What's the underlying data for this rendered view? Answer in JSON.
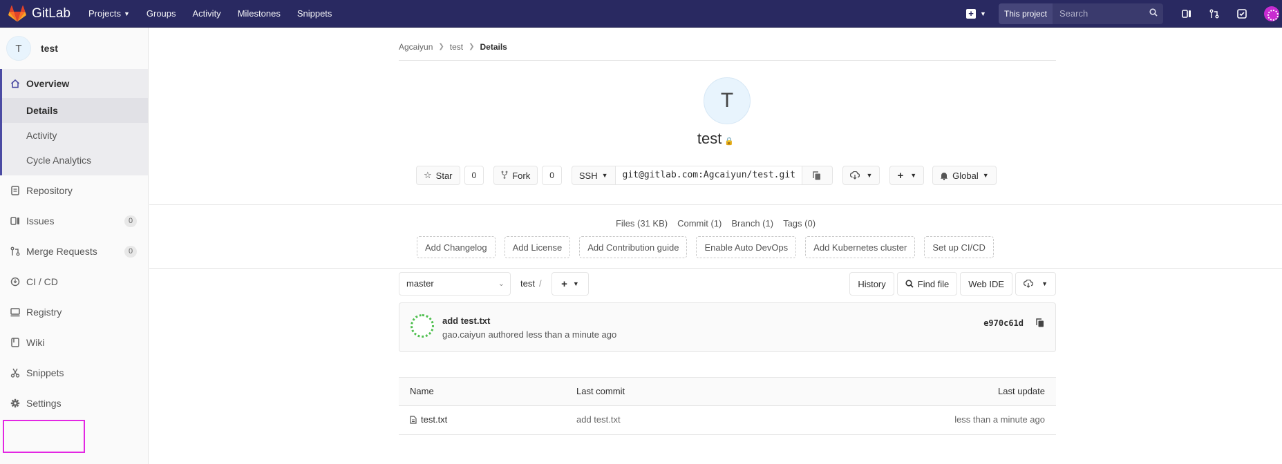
{
  "nav": {
    "brand": "GitLab",
    "links": [
      "Projects",
      "Groups",
      "Activity",
      "Milestones",
      "Snippets"
    ],
    "search_scope": "This project",
    "search_placeholder": "Search"
  },
  "sidebar": {
    "avatar_letter": "T",
    "project_name": "test",
    "overview": "Overview",
    "overview_items": [
      "Details",
      "Activity",
      "Cycle Analytics"
    ],
    "items": [
      {
        "label": "Repository"
      },
      {
        "label": "Issues",
        "count": "0"
      },
      {
        "label": "Merge Requests",
        "count": "0"
      },
      {
        "label": "CI / CD"
      },
      {
        "label": "Registry"
      },
      {
        "label": "Wiki"
      },
      {
        "label": "Snippets"
      },
      {
        "label": "Settings"
      }
    ]
  },
  "breadcrumb": [
    "Agcaiyun",
    "test",
    "Details"
  ],
  "project": {
    "avatar_letter": "T",
    "title": "test",
    "star_label": "Star",
    "star_count": "0",
    "fork_label": "Fork",
    "fork_count": "0",
    "clone_protocol": "SSH",
    "clone_url": "git@gitlab.com:Agcaiyun/test.git",
    "notification": "Global"
  },
  "stats": [
    "Files (31 KB)",
    "Commit (1)",
    "Branch (1)",
    "Tags (0)"
  ],
  "quick_actions": [
    "Add Changelog",
    "Add License",
    "Add Contribution guide",
    "Enable Auto DevOps",
    "Add Kubernetes cluster",
    "Set up CI/CD"
  ],
  "toolbar": {
    "branch": "master",
    "path": "test",
    "history": "History",
    "find_file": "Find file",
    "web_ide": "Web IDE"
  },
  "commit": {
    "title": "add test.txt",
    "meta": "gao.caiyun authored less than a minute ago",
    "sha": "e970c61d"
  },
  "file_table": {
    "headers": [
      "Name",
      "Last commit",
      "Last update"
    ],
    "rows": [
      {
        "name": "test.txt",
        "last_commit": "add test.txt",
        "last_update": "less than a minute ago"
      }
    ]
  },
  "colors": {
    "navbar": "#292961",
    "highlight": "#e327e3"
  }
}
